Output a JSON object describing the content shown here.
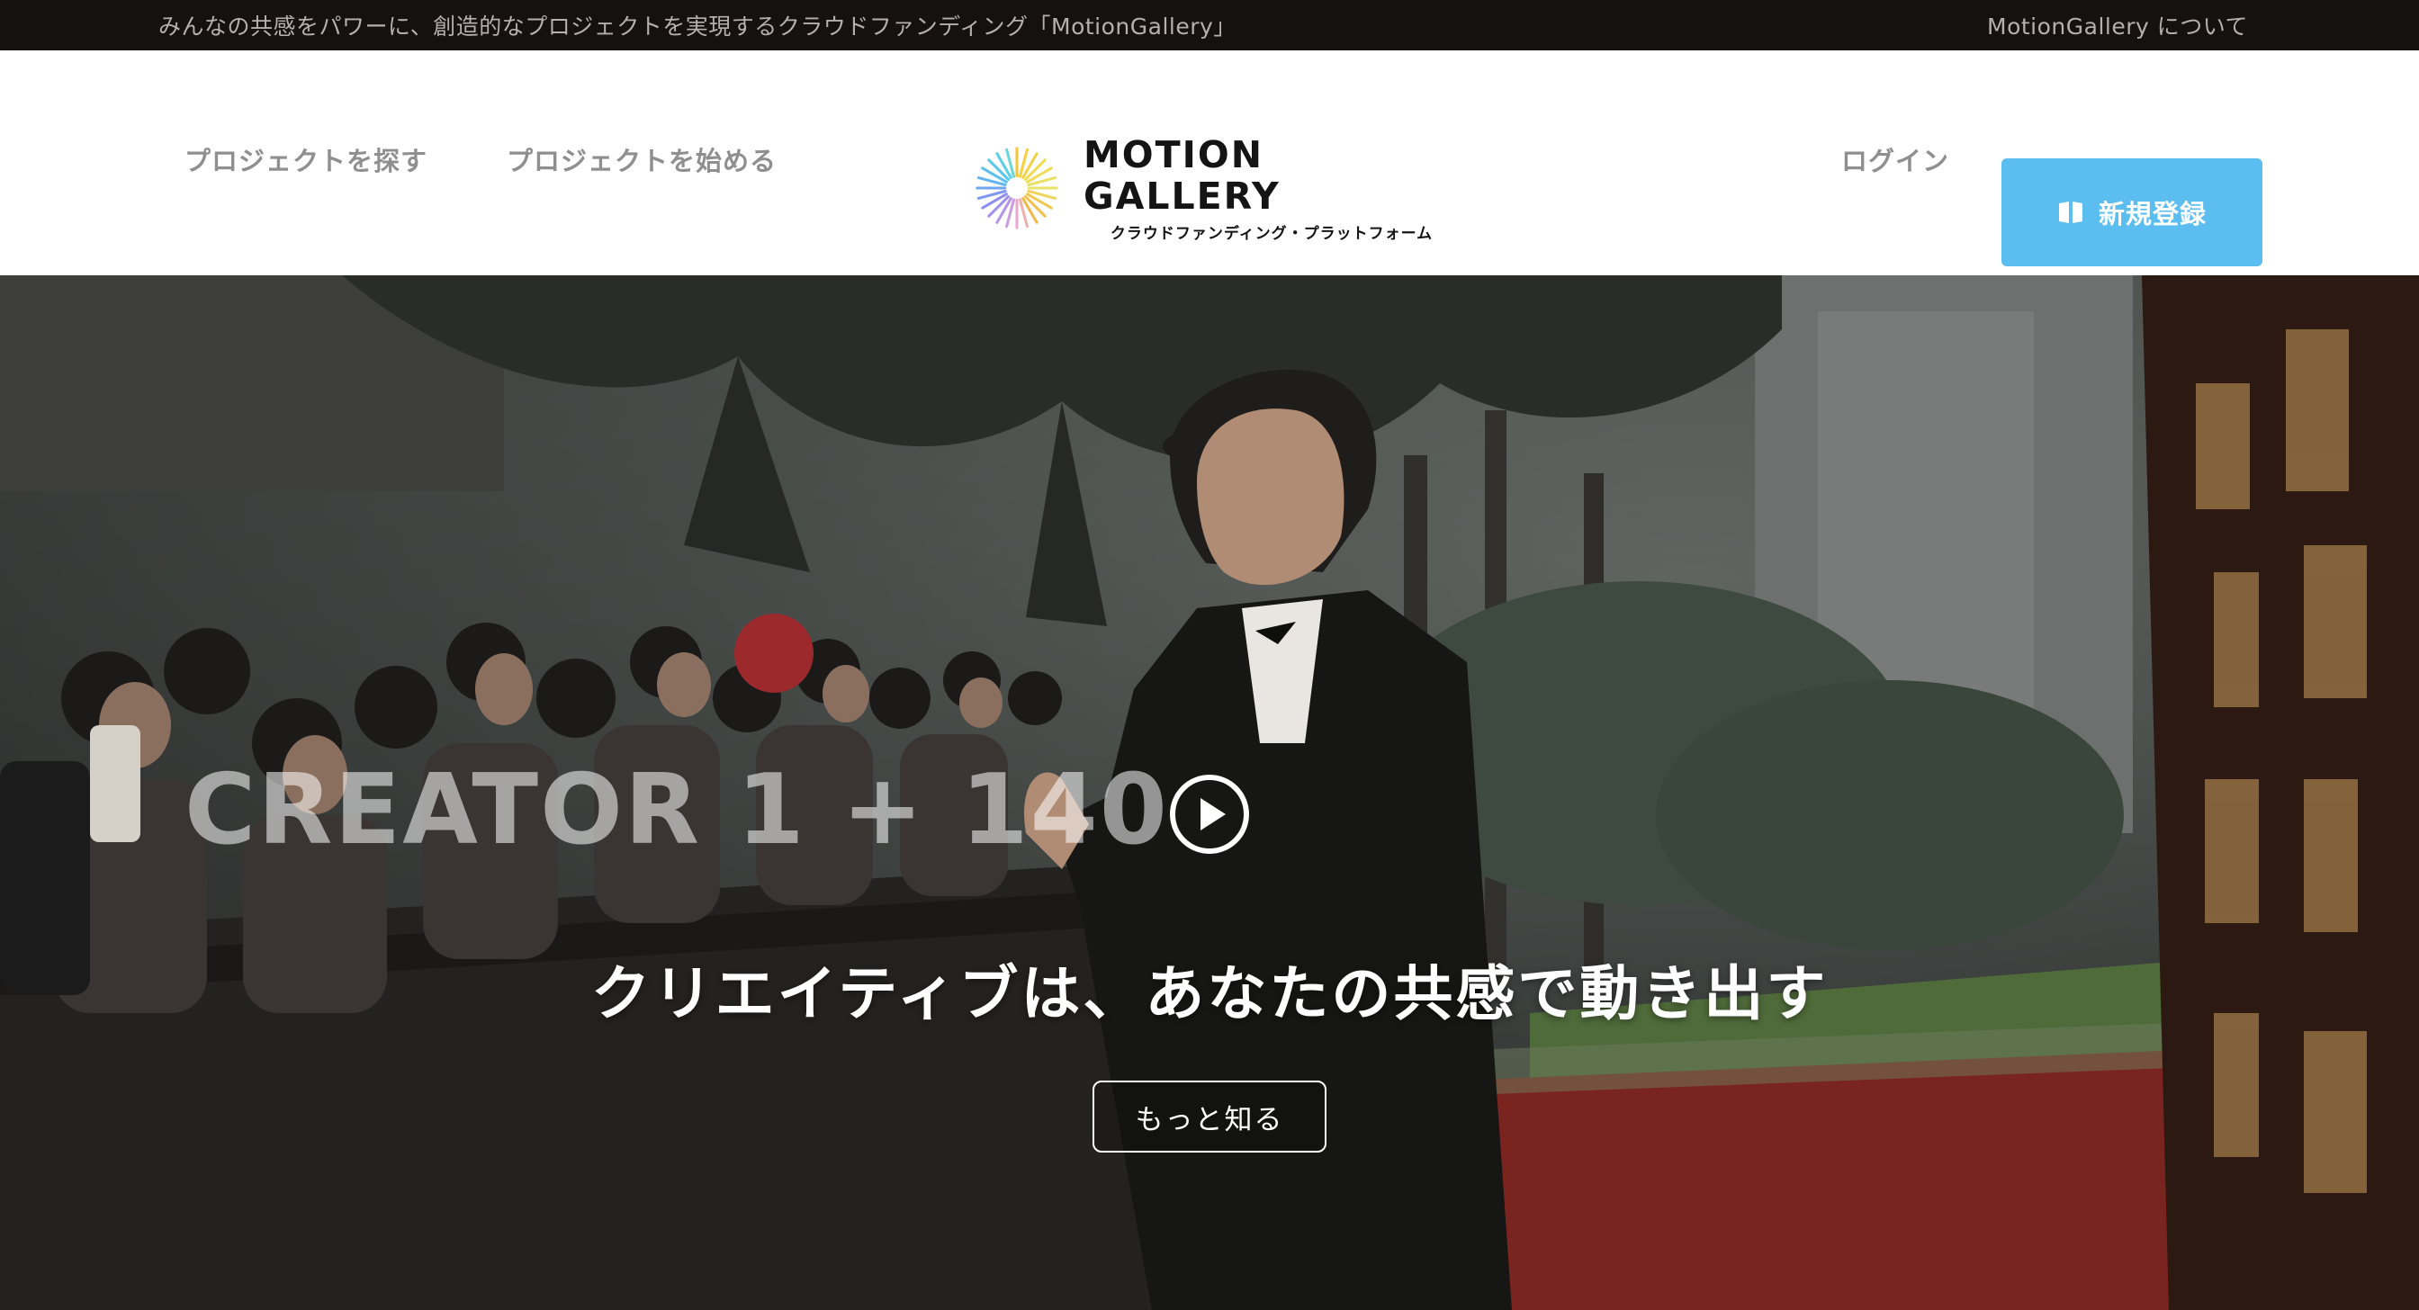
{
  "topbar": {
    "tagline": "みんなの共感をパワーに、創造的なプロジェクトを実現するクラウドファンディング「MotionGallery」",
    "about_link": "MotionGallery について"
  },
  "header": {
    "nav_find": "プロジェクトを探す",
    "nav_start": "プロジェクトを始める",
    "logo_title": "MOTION GALLERY",
    "logo_subtitle": "クラウドファンディング・プラットフォーム",
    "login": "ログイン",
    "signup": "新規登録",
    "signup_color": "#5bbdf0"
  },
  "hero": {
    "watermark": "CREATOR 1 + 140",
    "headline": "クリエイティブは、あなたの共感で動き出す",
    "learn_more": "もっと知る",
    "play_icon": "play-icon"
  }
}
